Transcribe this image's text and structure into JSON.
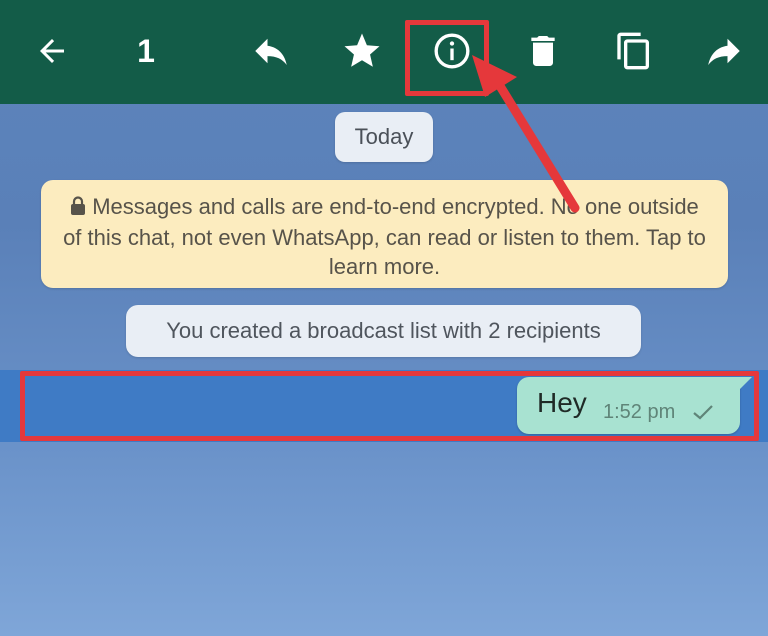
{
  "toolbar": {
    "back_icon": "arrow-left-icon",
    "selected_count": "1",
    "actions": [
      {
        "name": "reply",
        "icon": "reply-icon"
      },
      {
        "name": "star",
        "icon": "star-icon"
      },
      {
        "name": "info",
        "icon": "info-icon"
      },
      {
        "name": "delete",
        "icon": "trash-icon"
      },
      {
        "name": "copy",
        "icon": "copy-icon"
      },
      {
        "name": "forward",
        "icon": "forward-icon"
      }
    ],
    "background": "#135c48"
  },
  "chat": {
    "date_label": "Today",
    "encryption_notice": "Messages and calls are end-to-end encrypted. No one outside of this chat, not even WhatsApp, can read or listen to them. Tap to learn more.",
    "system_message": "You created a broadcast list with 2 recipients",
    "message": {
      "text": "Hey",
      "time": "1:52 pm",
      "status_icon": "single-check-icon",
      "selected": true
    }
  },
  "annotations": {
    "highlight_color": "#e5383b",
    "arrow_color": "#e5383b"
  }
}
